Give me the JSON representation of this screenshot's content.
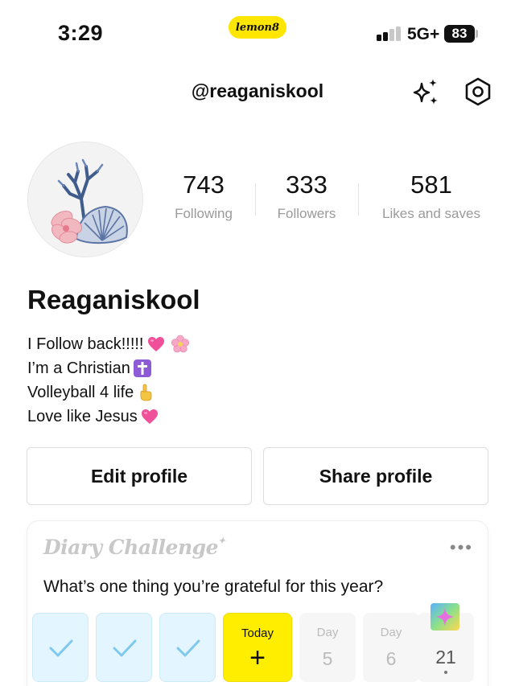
{
  "status_bar": {
    "time": "3:29",
    "app_badge": "lemon8",
    "network": "5G+",
    "battery": "83"
  },
  "header": {
    "username": "@reaganiskool",
    "icons": [
      "sparkle-icon",
      "settings-hexagon-icon"
    ]
  },
  "profile": {
    "display_name": "Reaganiskool",
    "stats": [
      {
        "value": "743",
        "label": "Following"
      },
      {
        "value": "333",
        "label": "Followers"
      },
      {
        "value": "581",
        "label": "Likes and saves"
      }
    ],
    "bio": [
      {
        "text": "I Follow back!!!!!",
        "emojis": [
          "pink-heart",
          "cherry-blossom"
        ]
      },
      {
        "text": "I’m a Christian",
        "emojis": [
          "latin-cross"
        ]
      },
      {
        "text": "Volleyball 4 life",
        "emojis": [
          "pointing-up-hand"
        ]
      },
      {
        "text": "Love like Jesus",
        "emojis": [
          "pink-heart"
        ]
      }
    ]
  },
  "actions": {
    "edit_label": "Edit profile",
    "share_label": "Share profile"
  },
  "diary": {
    "logo_text": "Diary Challenge",
    "question": "What’s one thing you’re grateful for this year?",
    "days": [
      {
        "state": "done"
      },
      {
        "state": "done"
      },
      {
        "state": "done"
      },
      {
        "state": "today",
        "label": "Today",
        "value": "+"
      },
      {
        "state": "future",
        "label": "Day",
        "value": "5"
      },
      {
        "state": "future",
        "label": "Day",
        "value": "6"
      },
      {
        "state": "last",
        "value": "21"
      }
    ]
  },
  "colors": {
    "accent_yellow": "#FFEE00",
    "done_blue": "#e3f5ff",
    "check_blue": "#7fc8ee",
    "muted_text": "#9a9a9a"
  }
}
